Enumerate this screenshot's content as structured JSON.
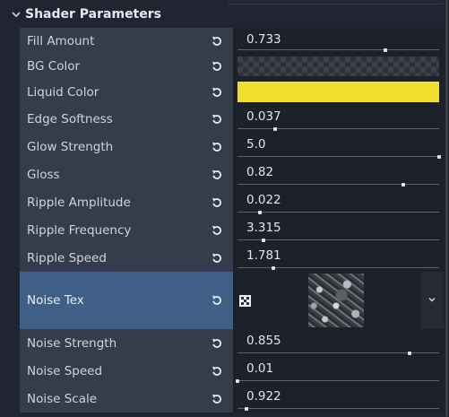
{
  "section": {
    "title": "Shader Parameters",
    "chevron_icon": "chevron-down-icon"
  },
  "reset_icon": "reset-arrow-icon",
  "colors": {
    "liquid": "#f0dd2c",
    "selected_row": "#3f5f86"
  },
  "params": [
    {
      "label": "Fill Amount",
      "value": "0.733",
      "level": 0.733
    },
    {
      "label": "BG Color"
    },
    {
      "label": "Liquid Color"
    },
    {
      "label": "Edge Softness",
      "value": "0.037",
      "level": 0.185
    },
    {
      "label": "Glow Strength",
      "value": "5.0",
      "level": 1.0
    },
    {
      "label": "Gloss",
      "value": "0.82",
      "level": 0.82
    },
    {
      "label": "Ripple Amplitude",
      "value": "0.022",
      "level": 0.11
    },
    {
      "label": "Ripple Frequency",
      "value": "3.315",
      "level": 0.131
    },
    {
      "label": "Ripple Speed",
      "value": "1.781",
      "level": 0.178
    },
    {
      "label": "Noise Tex",
      "texture_icon": "noise-texture-icon",
      "dropdown_icon": "chevron-down-icon"
    },
    {
      "label": "Noise Strength",
      "value": "0.855",
      "level": 0.855
    },
    {
      "label": "Noise Speed",
      "value": "0.01",
      "level": 0.0
    },
    {
      "label": "Noise Scale",
      "value": "0.922",
      "level": 0.046
    }
  ]
}
